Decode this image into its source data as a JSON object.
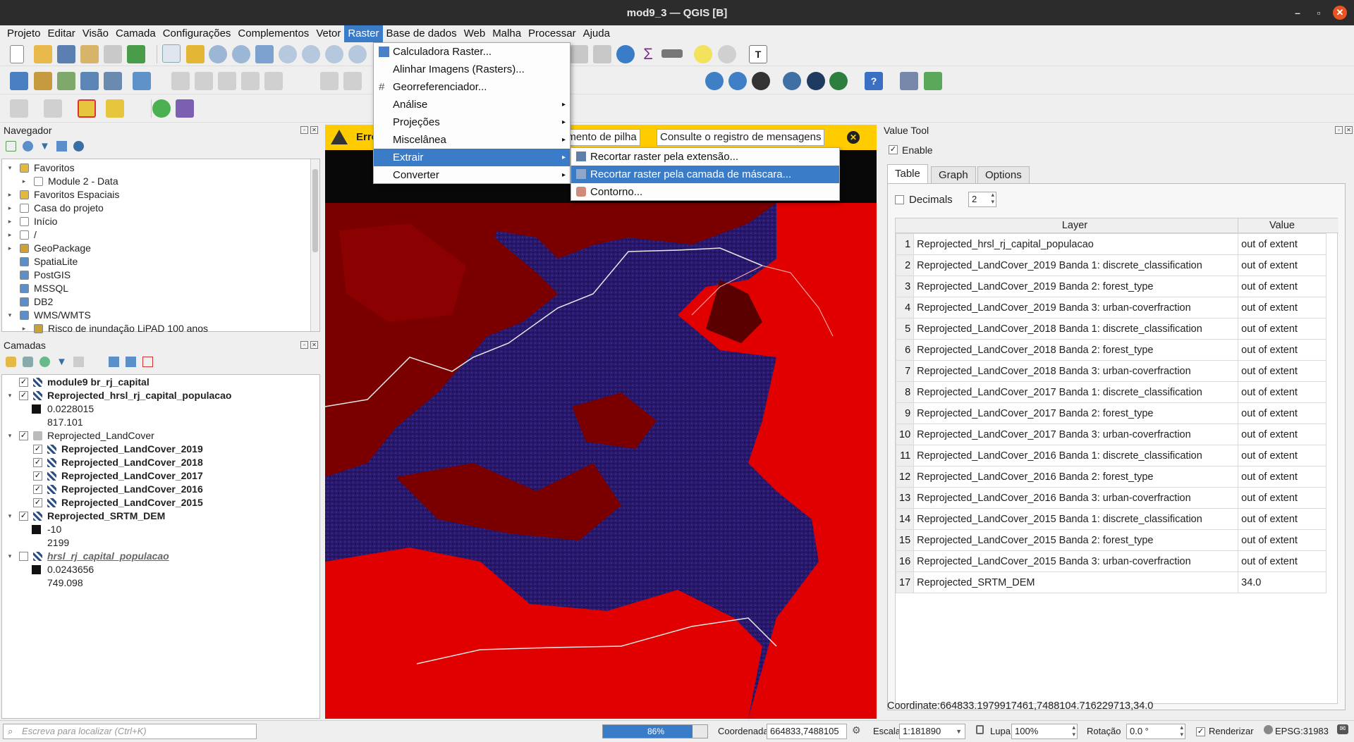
{
  "window": {
    "title": "mod9_3 — QGIS [B]",
    "close": "✕",
    "minimize": "–",
    "maximize": "▫"
  },
  "menubar": [
    "Projeto",
    "Editar",
    "Visão",
    "Camada",
    "Configurações",
    "Complementos",
    "Vetor",
    "Raster",
    "Base de dados",
    "Web",
    "Malha",
    "Processar",
    "Ajuda"
  ],
  "raster_menu": {
    "items": [
      "Calculadora Raster...",
      "Alinhar Imagens (Rasters)...",
      "Georreferenciador...",
      "Análise",
      "Projeções",
      "Miscelânea",
      "Extrair",
      "Converter"
    ],
    "submenu_arrow": "▸"
  },
  "extrair_menu": [
    "Recortar raster pela extensão...",
    "Recortar raster pela camada de máscara...",
    "Contorno..."
  ],
  "navigator": {
    "title": "Navegador",
    "items": [
      {
        "label": "Favoritos",
        "level": 0,
        "expanded": true
      },
      {
        "label": "Module 2 - Data",
        "level": 1,
        "expanded": false
      },
      {
        "label": "Favoritos Espaciais",
        "level": 0,
        "expanded": false
      },
      {
        "label": "Casa do projeto",
        "level": 0,
        "expanded": false
      },
      {
        "label": "Início",
        "level": 0,
        "expanded": false
      },
      {
        "label": "/",
        "level": 0,
        "expanded": false
      },
      {
        "label": "GeoPackage",
        "level": 0,
        "expanded": false
      },
      {
        "label": "SpatiaLite",
        "level": 0,
        "expanded": null
      },
      {
        "label": "PostGIS",
        "level": 0,
        "expanded": null
      },
      {
        "label": "MSSQL",
        "level": 0,
        "expanded": null
      },
      {
        "label": "DB2",
        "level": 0,
        "expanded": null
      },
      {
        "label": "WMS/WMTS",
        "level": 0,
        "expanded": true
      },
      {
        "label": "Risco de inundação LiPAD 100 anos",
        "level": 1,
        "expanded": false
      }
    ]
  },
  "layers": {
    "title": "Camadas",
    "items": [
      {
        "label": "module9 br_rj_capital",
        "bold": true,
        "checked": true,
        "indent": 1,
        "arrow": ""
      },
      {
        "label": "Reprojected_hrsl_rj_capital_populacao",
        "bold": true,
        "checked": true,
        "indent": 1,
        "arrow": "▾"
      },
      {
        "label": "0.0228015",
        "legend": true,
        "indent": 2
      },
      {
        "label": "817.101",
        "legend": false,
        "indent": 2
      },
      {
        "label": "Reprojected_LandCover",
        "bold": false,
        "checked": true,
        "indent": 1,
        "arrow": "▾",
        "group": true
      },
      {
        "label": "Reprojected_LandCover_2019",
        "bold": true,
        "checked": true,
        "indent": 2,
        "arrow": ""
      },
      {
        "label": "Reprojected_LandCover_2018",
        "bold": true,
        "checked": true,
        "indent": 2,
        "arrow": ""
      },
      {
        "label": "Reprojected_LandCover_2017",
        "bold": true,
        "checked": true,
        "indent": 2,
        "arrow": ""
      },
      {
        "label": "Reprojected_LandCover_2016",
        "bold": true,
        "checked": true,
        "indent": 2,
        "arrow": ""
      },
      {
        "label": "Reprojected_LandCover_2015",
        "bold": true,
        "checked": true,
        "indent": 2,
        "arrow": ""
      },
      {
        "label": "Reprojected_SRTM_DEM",
        "bold": true,
        "checked": true,
        "indent": 1,
        "arrow": "▾"
      },
      {
        "label": "-10",
        "legend": true,
        "indent": 2
      },
      {
        "label": "2199",
        "legend": false,
        "indent": 2
      },
      {
        "label": "hrsl_rj_capital_populacao",
        "bold": true,
        "italic": true,
        "checked": false,
        "indent": 1,
        "arrow": "▾"
      },
      {
        "label": "0.0243656",
        "legend": true,
        "indent": 2
      },
      {
        "label": "749.098",
        "legend": false,
        "indent": 2
      }
    ]
  },
  "messagebar": {
    "error": "Erro",
    "stack_button": "amento de pilha",
    "log_button": "Consulte o registro de mensagens"
  },
  "value_tool": {
    "title": "Value Tool",
    "enable": "Enable",
    "tabs": [
      "Table",
      "Graph",
      "Options"
    ],
    "decimals_label": "Decimals",
    "decimals_value": "2",
    "col_layer": "Layer",
    "col_value": "Value",
    "rows": [
      [
        "1",
        "Reprojected_hrsl_rj_capital_populacao",
        "out of extent"
      ],
      [
        "2",
        "Reprojected_LandCover_2019 Banda 1: discrete_classification",
        "out of extent"
      ],
      [
        "3",
        "Reprojected_LandCover_2019 Banda 2: forest_type",
        "out of extent"
      ],
      [
        "4",
        "Reprojected_LandCover_2019 Banda 3: urban-coverfraction",
        "out of extent"
      ],
      [
        "5",
        "Reprojected_LandCover_2018 Banda 1: discrete_classification",
        "out of extent"
      ],
      [
        "6",
        "Reprojected_LandCover_2018 Banda 2: forest_type",
        "out of extent"
      ],
      [
        "7",
        "Reprojected_LandCover_2018 Banda 3: urban-coverfraction",
        "out of extent"
      ],
      [
        "8",
        "Reprojected_LandCover_2017 Banda 1: discrete_classification",
        "out of extent"
      ],
      [
        "9",
        "Reprojected_LandCover_2017 Banda 2: forest_type",
        "out of extent"
      ],
      [
        "10",
        "Reprojected_LandCover_2017 Banda 3: urban-coverfraction",
        "out of extent"
      ],
      [
        "11",
        "Reprojected_LandCover_2016 Banda 1: discrete_classification",
        "out of extent"
      ],
      [
        "12",
        "Reprojected_LandCover_2016 Banda 2: forest_type",
        "out of extent"
      ],
      [
        "13",
        "Reprojected_LandCover_2016 Banda 3: urban-coverfraction",
        "out of extent"
      ],
      [
        "14",
        "Reprojected_LandCover_2015 Banda 1: discrete_classification",
        "out of extent"
      ],
      [
        "15",
        "Reprojected_LandCover_2015 Banda 2: forest_type",
        "out of extent"
      ],
      [
        "16",
        "Reprojected_LandCover_2015 Banda 3: urban-coverfraction",
        "out of extent"
      ],
      [
        "17",
        "Reprojected_SRTM_DEM",
        "34.0"
      ]
    ],
    "coordinate": "Coordinate:664833.1979917461,7488104.716229713,34.0"
  },
  "statusbar": {
    "search_placeholder": "Escreva para localizar (Ctrl+K)",
    "progress": "86%",
    "progress_fraction": 0.86,
    "coord_label": "Coordenada",
    "coord_value": "664833,7488105",
    "scale_label": "Escala",
    "scale_value": "1:181890",
    "magnifier_label": "Lupa",
    "magnifier_value": "100%",
    "rotation_label": "Rotação",
    "rotation_value": "0.0 °",
    "render_label": "Renderizar",
    "epsg": "EPSG:31983"
  },
  "colors": {
    "accent": "#3a7cc7",
    "map_red": "#e00000",
    "map_dark": "#7a0000",
    "map_purple": "#2a1a6e",
    "warning": "#ffcc00"
  }
}
